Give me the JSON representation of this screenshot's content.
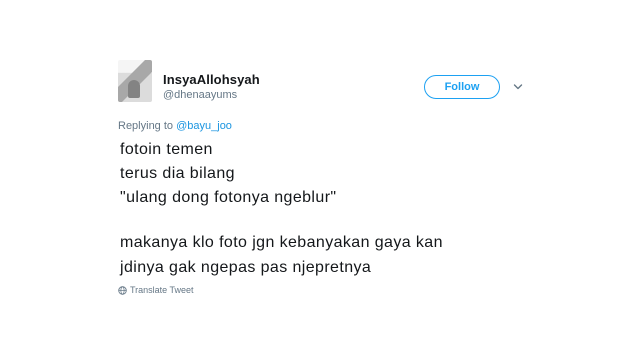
{
  "tweet": {
    "display_name": "InsyaAllohsyah",
    "handle": "@dhenaayums",
    "follow_label": "Follow",
    "reply_prefix": "Replying to",
    "reply_to": "@bayu_joo",
    "lines": [
      "fotoin temen",
      "terus dia bilang",
      "\"ulang dong fotonya ngeblur\"",
      "makanya klo foto jgn kebanyakan gaya kan",
      "jdinya gak ngepas pas njepretnya"
    ],
    "translate_label": "Translate Tweet"
  },
  "colors": {
    "accent": "#1da1f2",
    "mention": "#1b95e0",
    "text": "#14171a",
    "muted": "#657786"
  },
  "icons": [
    "avatar",
    "chevron-down-icon",
    "globe-icon"
  ]
}
